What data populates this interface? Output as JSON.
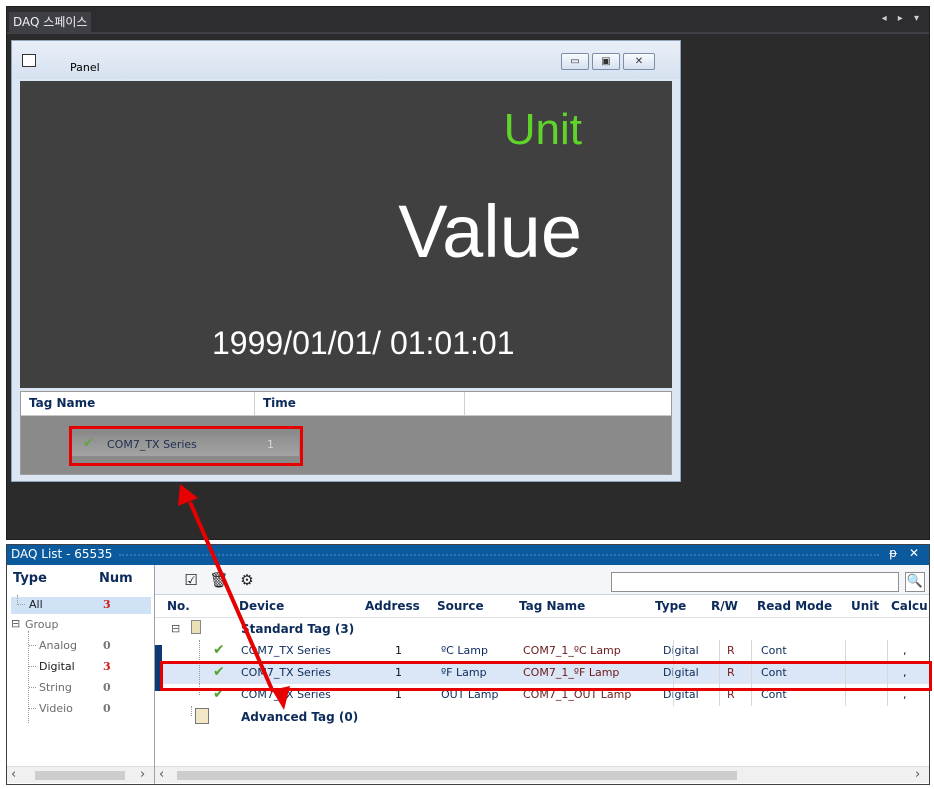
{
  "workspace": {
    "tab_label": "DAQ 스페이스",
    "controls": "◂ ▸ ▾"
  },
  "panel": {
    "title": "Panel",
    "min_glyph": "▭",
    "max_glyph": "▣",
    "close_glyph": "✕",
    "unit": "Unit",
    "value": "Value",
    "datetime": "1999/01/01/ 01:01:01",
    "unit_color": "#5fd52a",
    "taglist": {
      "columns": [
        "Tag Name",
        "Time"
      ],
      "rows": [
        {
          "check": "✔",
          "name": "COM7_TX Series",
          "time": "1"
        }
      ]
    }
  },
  "daq_list": {
    "title": "DAQ List - 65535",
    "controls": "ᵽ ✕",
    "type_pane": {
      "header_type": "Type",
      "header_num": "Num",
      "items": [
        {
          "label": "All",
          "num": "3"
        },
        {
          "label": "Group",
          "num": ""
        },
        {
          "label": "Analog",
          "num": "0"
        },
        {
          "label": "Digital",
          "num": "3"
        },
        {
          "label": "String",
          "num": "0"
        },
        {
          "label": "Videio",
          "num": "0"
        }
      ],
      "expand_glyph": "⊟"
    },
    "toolbar": {
      "check_icon": "☑",
      "delete_icon": "🗑",
      "settings_icon": "⚙",
      "search_value": "",
      "search_icon": "🔍"
    },
    "columns": [
      "No.",
      "Device",
      "Address",
      "Source",
      "Tag Name",
      "Type",
      "R/W",
      "Read Mode",
      "Unit",
      "Calcu"
    ],
    "groups": {
      "standard": "Standard Tag (3)",
      "advanced": "Advanced Tag (0)"
    },
    "rows": [
      {
        "device": "COM7_TX Series",
        "address": "1",
        "source": "ºC Lamp",
        "tag": "COM7_1_ºC Lamp",
        "type": "Digital",
        "rw": "R",
        "mode": "Cont",
        "unit": "",
        "calc": ","
      },
      {
        "device": "COM7_TX Series",
        "address": "1",
        "source": "ºF Lamp",
        "tag": "COM7_1_ºF Lamp",
        "type": "Digital",
        "rw": "R",
        "mode": "Cont",
        "unit": "",
        "calc": ","
      },
      {
        "device": "COM7_TX Series",
        "address": "1",
        "source": "OUT Lamp",
        "tag": "COM7_1_OUT Lamp",
        "type": "Digital",
        "rw": "R",
        "mode": "Cont",
        "unit": "",
        "calc": ","
      }
    ],
    "check_glyph": "✔",
    "scroll_left": "‹",
    "scroll_right": "›"
  },
  "colors": {
    "highlight_red": "#e60000",
    "title_blue": "#0b5a9e",
    "count_red": "#d11a1a"
  }
}
